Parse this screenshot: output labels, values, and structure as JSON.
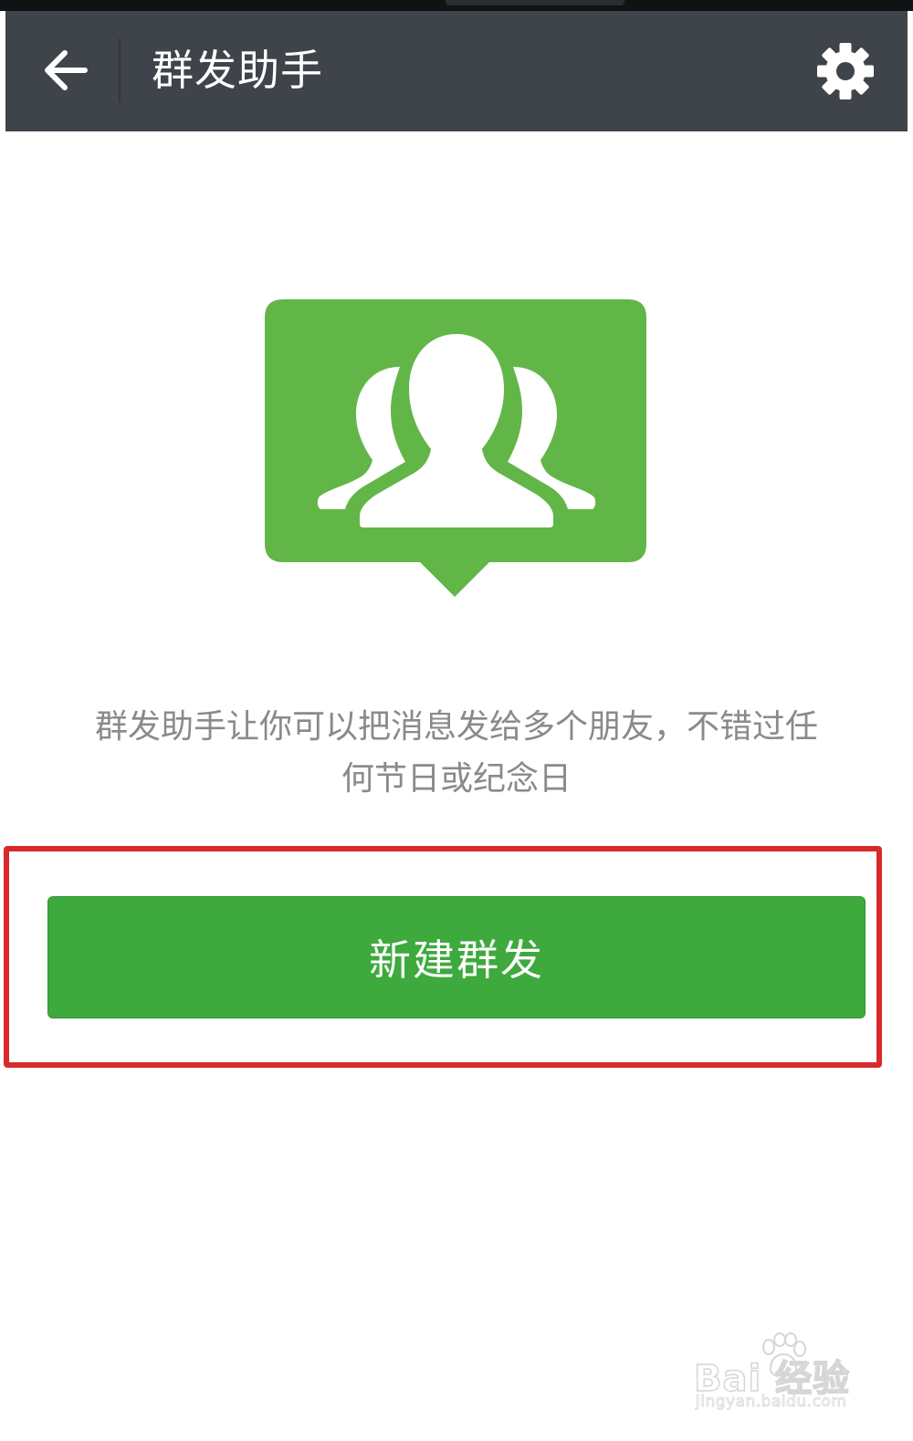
{
  "app_bar": {
    "title": "群发助手",
    "back_icon": "back-arrow-icon",
    "settings_icon": "gear-icon",
    "background": "#3f434a"
  },
  "hero": {
    "icon": "group-chat-icon",
    "color": "#62b648"
  },
  "description": {
    "line1": "群发助手让你可以把消息发给多个朋友，不错过任",
    "line2": "何节日或纪念日"
  },
  "primary_button": {
    "label": "新建群发",
    "color": "#3ea93d"
  },
  "highlight": {
    "color": "#d9292a"
  },
  "watermark": {
    "brand": "Bai 经验",
    "url": "jingyan.baidu.com"
  }
}
